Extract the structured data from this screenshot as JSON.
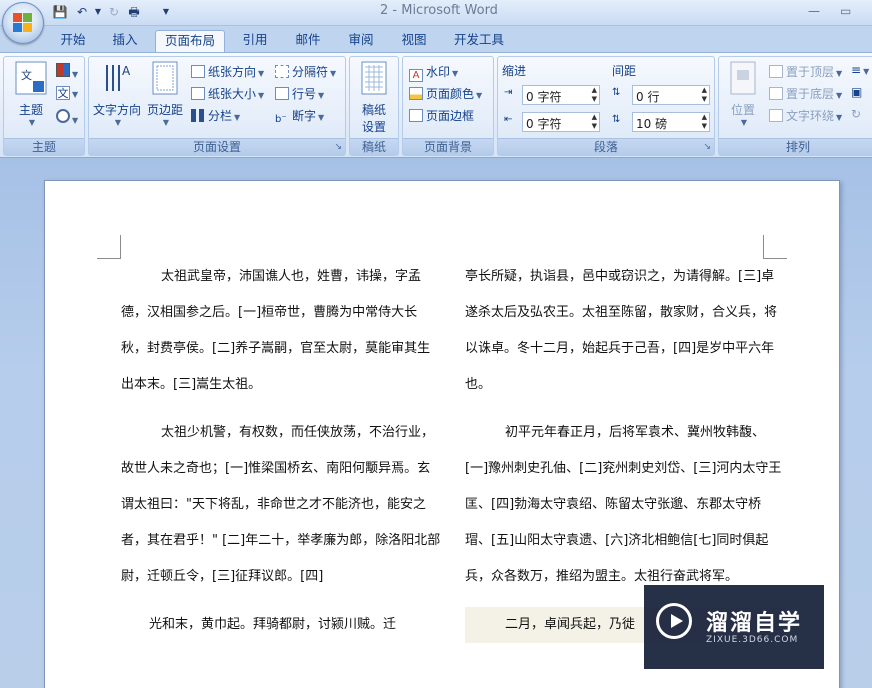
{
  "window": {
    "title": "2 - Microsoft Word"
  },
  "tabs": [
    {
      "label": "开始"
    },
    {
      "label": "插入"
    },
    {
      "label": "页面布局"
    },
    {
      "label": "引用"
    },
    {
      "label": "邮件"
    },
    {
      "label": "审阅"
    },
    {
      "label": "视图"
    },
    {
      "label": "开发工具"
    }
  ],
  "ribbon": {
    "theme": {
      "label": "主题",
      "group_label": "主题"
    },
    "page_setup": {
      "text_direction": "文字方向",
      "margins": "页边距",
      "orientation": "纸张方向",
      "size": "纸张大小",
      "columns": "分栏",
      "breaks": "分隔符",
      "line_numbers": "行号",
      "hyphenation": "断字",
      "group_label": "页面设置"
    },
    "draft": {
      "label_line1": "稿纸",
      "label_line2": "设置",
      "group_label": "稿纸"
    },
    "page_background": {
      "watermark": "水印",
      "page_color": "页面颜色",
      "page_borders": "页面边框",
      "group_label": "页面背景"
    },
    "paragraph": {
      "indent_label": "缩进",
      "spacing_label": "间距",
      "indent_left": "0 字符",
      "indent_right": "0 字符",
      "spacing_before": "0 行",
      "spacing_after": "10 磅",
      "group_label": "段落"
    },
    "arrange": {
      "position": "位置",
      "bring_to_front": "置于顶层",
      "send_to_back": "置于底层",
      "text_wrapping": "文字环绕",
      "group_label": "排列"
    }
  },
  "document": {
    "left_column": [
      "太祖武皇帝，沛国谯人也，姓曹，讳操，字孟德，汉相国参之后。[一]桓帝世，曹腾为中常侍大长秋，封费亭侯。[二]养子嵩嗣，官至太尉，莫能审其生出本末。[三]嵩生太祖。",
      "太祖少机警，有权数，而任侠放荡，不治行业，故世人未之奇也；[一]惟梁国桥玄、南阳何颙异焉。玄谓太祖曰：\"天下将乱，非命世之才不能济也，能安之者，其在君乎！\"  [二]年二十，举孝廉为郎，除洛阳北部尉，迁顿丘令，[三]征拜议郎。[四]",
      "光和末，黄巾起。拜骑都尉，讨颍川贼。迁"
    ],
    "right_column": [
      "亭长所疑，执诣县，邑中或窃识之，为请得解。[三]卓遂杀太后及弘农王。太祖至陈留，散家财，合义兵，将以诛卓。冬十二月，始起兵于己吾，[四]是岁中平六年也。",
      "初平元年春正月，后将军袁术、冀州牧韩馥、[一]豫州刺史孔伷、[二]兖州刺史刘岱、[三]河内太守王匡、[四]勃海太守袁绍、陈留太守张邈、东郡太守桥瑁、[五]山阳太守袁遗、[六]济北相鲍信[七]同时俱起兵，众各数万，推绍为盟主。太祖行奋武将军。",
      "二月，卓闻兵起，乃徙"
    ]
  },
  "watermark": {
    "title": "溜溜自学",
    "url": "ZIXUE.3D66.COM"
  }
}
